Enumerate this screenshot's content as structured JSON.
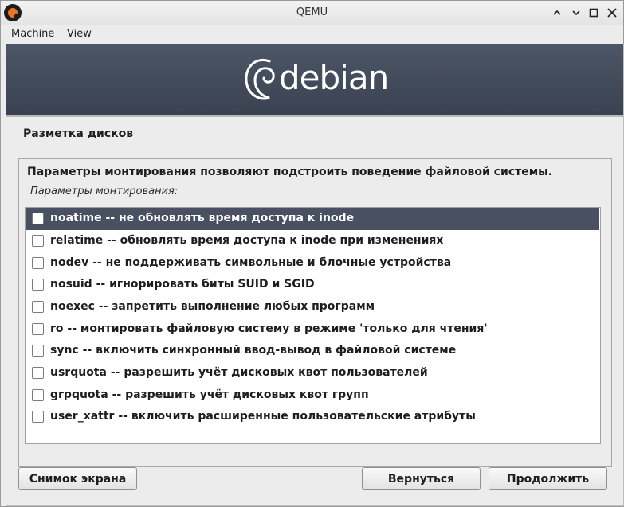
{
  "window": {
    "title": "QEMU",
    "controls": {
      "minimize": "–",
      "maximize": "□",
      "close": "✕"
    },
    "menu": [
      "Machine",
      "View"
    ]
  },
  "installer": {
    "brand": "debian",
    "section_title": "Разметка дисков",
    "description": "Параметры монтирования позволяют подстроить поведение файловой системы.",
    "list_caption": "Параметры монтирования:",
    "options": [
      {
        "label": "noatime -- не обновлять время доступа к inode",
        "checked": false,
        "selected": true
      },
      {
        "label": "relatime -- обновлять время доступа к inode при изменениях",
        "checked": false,
        "selected": false
      },
      {
        "label": "nodev -- не поддерживать символьные и блочные устройства",
        "checked": false,
        "selected": false
      },
      {
        "label": "nosuid -- игнорировать биты SUID и SGID",
        "checked": false,
        "selected": false
      },
      {
        "label": "noexec -- запретить выполнение любых программ",
        "checked": false,
        "selected": false
      },
      {
        "label": "ro -- монтировать файловую систему в режиме 'только для чтения'",
        "checked": false,
        "selected": false
      },
      {
        "label": "sync -- включить синхронный ввод-вывод в файловой системе",
        "checked": false,
        "selected": false
      },
      {
        "label": "usrquota -- разрешить учёт дисковых квот пользователей",
        "checked": false,
        "selected": false
      },
      {
        "label": "grpquota -- разрешить учёт дисковых квот групп",
        "checked": false,
        "selected": false
      },
      {
        "label": "user_xattr -- включить расширенные пользовательские атрибуты",
        "checked": false,
        "selected": false
      }
    ],
    "buttons": {
      "screenshot": "Снимок экрана",
      "back": "Вернуться",
      "continue": "Продолжить"
    }
  }
}
